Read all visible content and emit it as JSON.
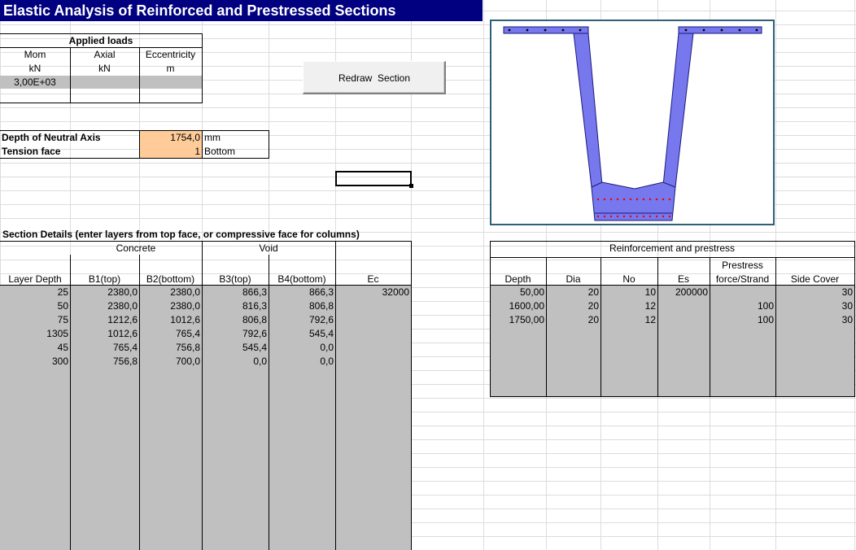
{
  "title": "Elastic Analysis of Reinforced and Prestressed Sections",
  "applied_loads": {
    "heading": "Applied loads",
    "columns": [
      {
        "name": "Mom",
        "unit": "kN"
      },
      {
        "name": "Axial",
        "unit": "kN"
      },
      {
        "name": "Eccentricity",
        "unit": "m"
      }
    ],
    "row1": {
      "mom": "3,00E+03",
      "axial": "",
      "ecc": ""
    }
  },
  "redraw_button": "Redraw  Section",
  "neutral_axis": {
    "depth_label": "Depth of Neutral Axis",
    "depth_value": "1754,0",
    "depth_unit": "mm",
    "tension_label": "Tension face",
    "tension_value": "1",
    "tension_unit": "Bottom"
  },
  "section_details": {
    "heading": "Section Details (enter layers from top face, or compressive face for columns)",
    "group_concrete": "Concrete",
    "group_void": "Void",
    "headers": [
      "Layer Depth",
      "B1(top)",
      "B2(bottom)",
      "B3(top)",
      "B4(bottom)",
      "Ec"
    ],
    "rows": [
      [
        "25",
        "2380,0",
        "2380,0",
        "866,3",
        "866,3",
        "32000"
      ],
      [
        "50",
        "2380,0",
        "2380,0",
        "816,3",
        "806,8",
        ""
      ],
      [
        "75",
        "1212,6",
        "1012,6",
        "806,8",
        "792,6",
        ""
      ],
      [
        "1305",
        "1012,6",
        "765,4",
        "792,6",
        "545,4",
        ""
      ],
      [
        "45",
        "765,4",
        "756,8",
        "545,4",
        "0,0",
        ""
      ],
      [
        "300",
        "756,8",
        "700,0",
        "0,0",
        "0,0",
        ""
      ]
    ]
  },
  "reinforcement": {
    "heading": "Reinforcement and prestress",
    "headers": [
      "Depth",
      "Dia",
      "No",
      "Es",
      "Prestress force/Strand",
      "Side Cover"
    ],
    "header_prestress_line1": "Prestress",
    "header_prestress_line2": "force/Strand",
    "rows": [
      [
        "50,00",
        "20",
        "10",
        "200000",
        "",
        "30"
      ],
      [
        "1600,00",
        "20",
        "12",
        "",
        "100",
        "30"
      ],
      [
        "1750,00",
        "20",
        "12",
        "",
        "100",
        "30"
      ]
    ]
  },
  "colors": {
    "title_bg": "#000080",
    "input_orange": "#ffcc99",
    "cell_gray": "#c0c0c0",
    "section_fill": "#7777ee",
    "diagram_border": "#2e5f7a",
    "strand_red": "#ee0000"
  }
}
